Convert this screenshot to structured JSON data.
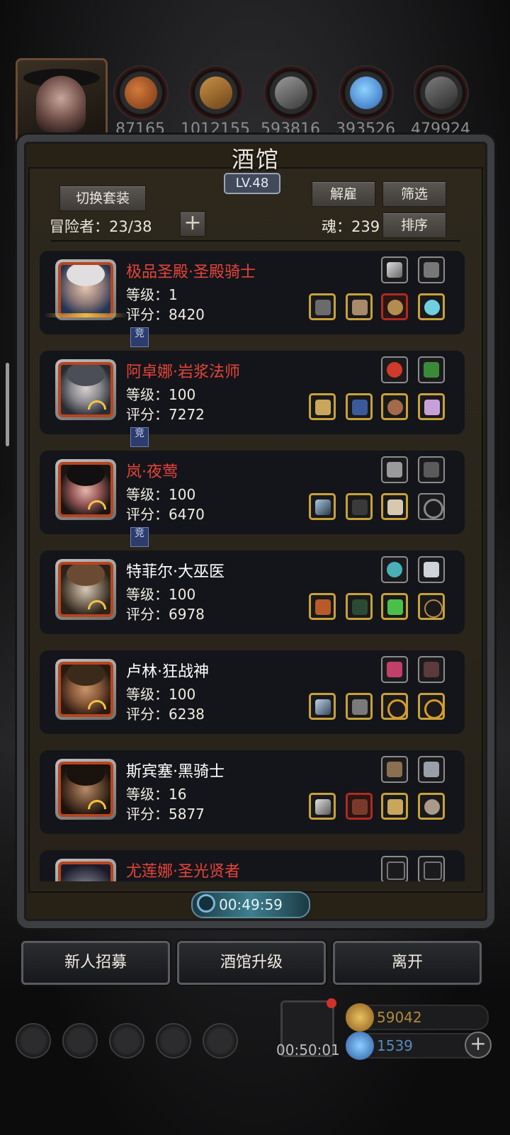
{
  "resources": [
    "87165",
    "1012155",
    "593816",
    "393526",
    "479924"
  ],
  "tavern": {
    "title": "酒馆",
    "level": "LV.48",
    "switch_outfit": "切换套装",
    "dismiss": "解雇",
    "filter": "筛选",
    "sort": "排序",
    "adventurers_label": "冒险者：23/38",
    "soul_label": "魂：239",
    "add_icon": "+"
  },
  "heroes": [
    {
      "name": "极品圣殿·圣殿骑士",
      "level": "等级：1",
      "score": "评分：8420",
      "highlight": true,
      "tag": "竞"
    },
    {
      "name": "阿卓娜·岩浆法师",
      "level": "等级：100",
      "score": "评分：7272",
      "highlight": true,
      "tag": "竞"
    },
    {
      "name": "岚·夜莺",
      "level": "等级：100",
      "score": "评分：6470",
      "highlight": true,
      "tag": "竞"
    },
    {
      "name": "特菲尔·大巫医",
      "level": "等级：100",
      "score": "评分：6978",
      "highlight": false
    },
    {
      "name": "卢林·狂战神",
      "level": "等级：100",
      "score": "评分：6238",
      "highlight": false
    },
    {
      "name": "斯宾塞·黑骑士",
      "level": "等级：16",
      "score": "评分：5877",
      "highlight": false
    },
    {
      "name": "尤莲娜·圣光贤者",
      "level": "",
      "score": "",
      "highlight": true
    }
  ],
  "timer": "00:49:59",
  "actions": {
    "recruit": "新人招募",
    "upgrade": "酒馆升级",
    "leave": "离开"
  },
  "gift_timer": "00:50:01",
  "currency": {
    "gold": "59042",
    "gems": "1539"
  }
}
